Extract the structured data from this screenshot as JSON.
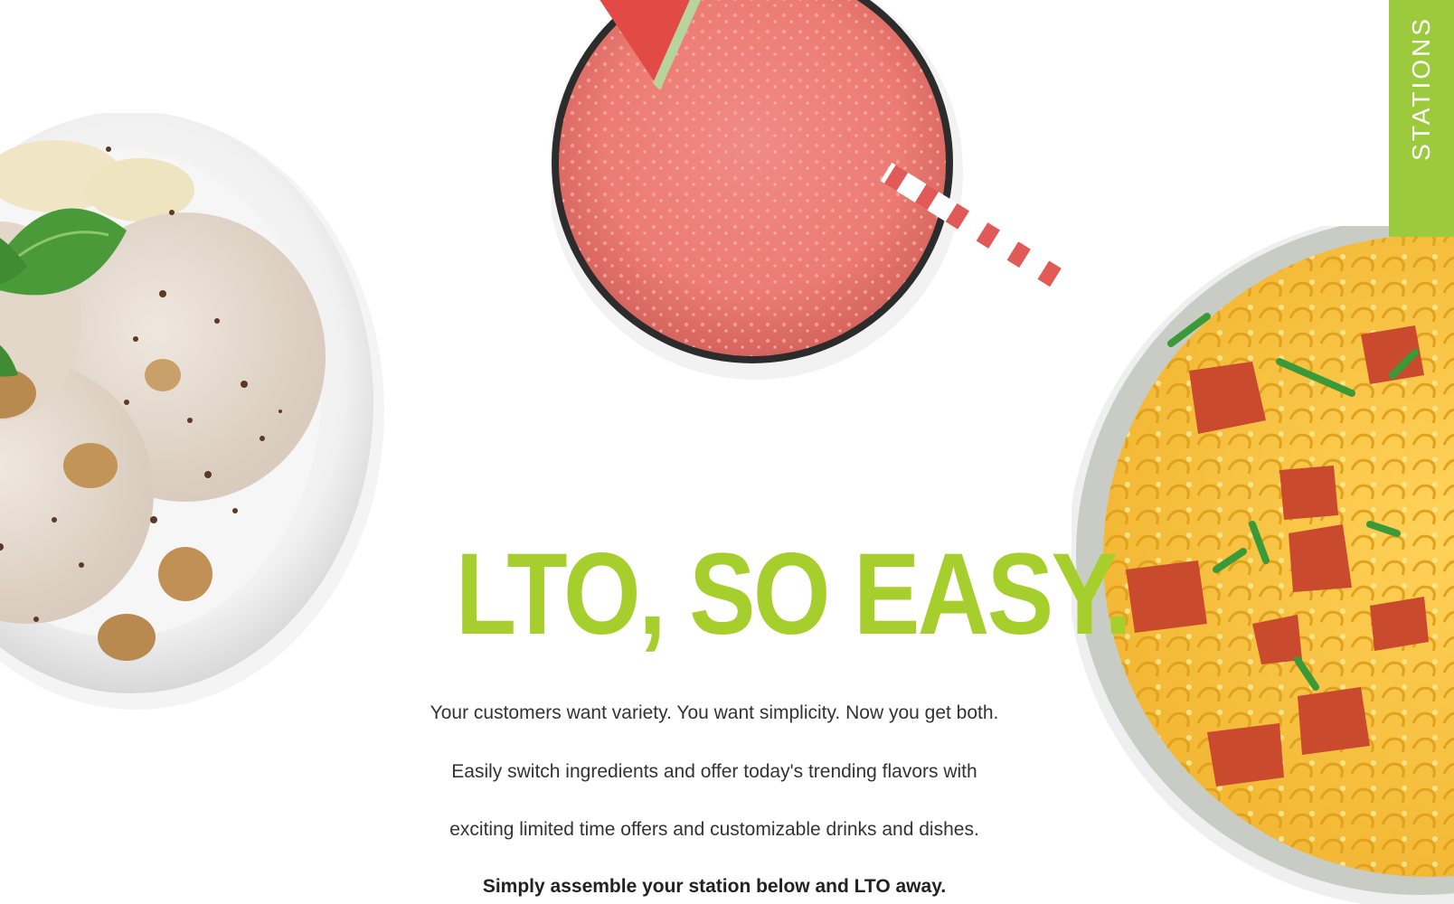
{
  "side_tab": {
    "label": "STATIONS"
  },
  "hero": {
    "headline": "LTO, SO EASY.",
    "paragraph_lines": [
      "Your customers want variety. You want simplicity. Now you get both.",
      "Easily switch ingredients and offer today's trending flavors with",
      "exciting limited time offers and customizable drinks and dishes."
    ],
    "cta_line": "Simply assemble your station below and LTO away."
  },
  "images": {
    "left": "ice-cream-bowl",
    "top": "watermelon-smoothie",
    "right": "mac-and-cheese-bowl"
  },
  "colors": {
    "accent": "#a6cf2e",
    "tab": "#9bcb3c",
    "text": "#333333",
    "background": "#ffffff"
  }
}
